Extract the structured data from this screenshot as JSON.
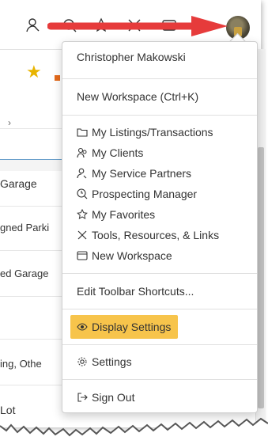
{
  "user": {
    "name": "Christopher Makowski"
  },
  "menu": {
    "new_workspace_shortcut": "New Workspace (Ctrl+K)",
    "items": [
      {
        "label": "My Listings/Transactions",
        "icon": "folder-icon"
      },
      {
        "label": "My Clients",
        "icon": "users-icon"
      },
      {
        "label": "My Service Partners",
        "icon": "service-partner-icon"
      },
      {
        "label": "Prospecting Manager",
        "icon": "clock-search-icon"
      },
      {
        "label": "My Favorites",
        "icon": "star-icon"
      },
      {
        "label": "Tools, Resources, & Links",
        "icon": "tools-icon"
      },
      {
        "label": "New Workspace",
        "icon": "workspace-icon"
      }
    ],
    "edit_toolbar": "Edit Toolbar Shortcuts...",
    "display_settings": "Display Settings",
    "settings": "Settings",
    "sign_out": "Sign Out"
  },
  "background_rows": [
    "Garage",
    "gned Parki",
    "ed Garage",
    "ing, Othe",
    "Lot"
  ],
  "colors": {
    "arrow": "#e63b3b",
    "highlight": "#f7c44b",
    "star": "#e8b400",
    "accent_orange": "#e46a1b"
  }
}
